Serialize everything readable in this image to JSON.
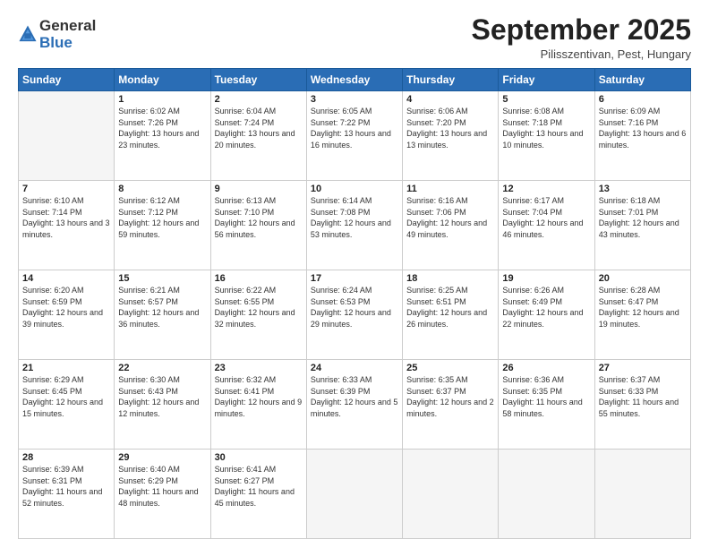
{
  "header": {
    "logo_general": "General",
    "logo_blue": "Blue",
    "month_title": "September 2025",
    "subtitle": "Pilisszentivan, Pest, Hungary"
  },
  "weekdays": [
    "Sunday",
    "Monday",
    "Tuesday",
    "Wednesday",
    "Thursday",
    "Friday",
    "Saturday"
  ],
  "weeks": [
    [
      {
        "day": "",
        "empty": true
      },
      {
        "day": "1",
        "sunrise": "6:02 AM",
        "sunset": "7:26 PM",
        "daylight": "13 hours and 23 minutes."
      },
      {
        "day": "2",
        "sunrise": "6:04 AM",
        "sunset": "7:24 PM",
        "daylight": "13 hours and 20 minutes."
      },
      {
        "day": "3",
        "sunrise": "6:05 AM",
        "sunset": "7:22 PM",
        "daylight": "13 hours and 16 minutes."
      },
      {
        "day": "4",
        "sunrise": "6:06 AM",
        "sunset": "7:20 PM",
        "daylight": "13 hours and 13 minutes."
      },
      {
        "day": "5",
        "sunrise": "6:08 AM",
        "sunset": "7:18 PM",
        "daylight": "13 hours and 10 minutes."
      },
      {
        "day": "6",
        "sunrise": "6:09 AM",
        "sunset": "7:16 PM",
        "daylight": "13 hours and 6 minutes."
      }
    ],
    [
      {
        "day": "7",
        "sunrise": "6:10 AM",
        "sunset": "7:14 PM",
        "daylight": "13 hours and 3 minutes."
      },
      {
        "day": "8",
        "sunrise": "6:12 AM",
        "sunset": "7:12 PM",
        "daylight": "12 hours and 59 minutes."
      },
      {
        "day": "9",
        "sunrise": "6:13 AM",
        "sunset": "7:10 PM",
        "daylight": "12 hours and 56 minutes."
      },
      {
        "day": "10",
        "sunrise": "6:14 AM",
        "sunset": "7:08 PM",
        "daylight": "12 hours and 53 minutes."
      },
      {
        "day": "11",
        "sunrise": "6:16 AM",
        "sunset": "7:06 PM",
        "daylight": "12 hours and 49 minutes."
      },
      {
        "day": "12",
        "sunrise": "6:17 AM",
        "sunset": "7:04 PM",
        "daylight": "12 hours and 46 minutes."
      },
      {
        "day": "13",
        "sunrise": "6:18 AM",
        "sunset": "7:01 PM",
        "daylight": "12 hours and 43 minutes."
      }
    ],
    [
      {
        "day": "14",
        "sunrise": "6:20 AM",
        "sunset": "6:59 PM",
        "daylight": "12 hours and 39 minutes."
      },
      {
        "day": "15",
        "sunrise": "6:21 AM",
        "sunset": "6:57 PM",
        "daylight": "12 hours and 36 minutes."
      },
      {
        "day": "16",
        "sunrise": "6:22 AM",
        "sunset": "6:55 PM",
        "daylight": "12 hours and 32 minutes."
      },
      {
        "day": "17",
        "sunrise": "6:24 AM",
        "sunset": "6:53 PM",
        "daylight": "12 hours and 29 minutes."
      },
      {
        "day": "18",
        "sunrise": "6:25 AM",
        "sunset": "6:51 PM",
        "daylight": "12 hours and 26 minutes."
      },
      {
        "day": "19",
        "sunrise": "6:26 AM",
        "sunset": "6:49 PM",
        "daylight": "12 hours and 22 minutes."
      },
      {
        "day": "20",
        "sunrise": "6:28 AM",
        "sunset": "6:47 PM",
        "daylight": "12 hours and 19 minutes."
      }
    ],
    [
      {
        "day": "21",
        "sunrise": "6:29 AM",
        "sunset": "6:45 PM",
        "daylight": "12 hours and 15 minutes."
      },
      {
        "day": "22",
        "sunrise": "6:30 AM",
        "sunset": "6:43 PM",
        "daylight": "12 hours and 12 minutes."
      },
      {
        "day": "23",
        "sunrise": "6:32 AM",
        "sunset": "6:41 PM",
        "daylight": "12 hours and 9 minutes."
      },
      {
        "day": "24",
        "sunrise": "6:33 AM",
        "sunset": "6:39 PM",
        "daylight": "12 hours and 5 minutes."
      },
      {
        "day": "25",
        "sunrise": "6:35 AM",
        "sunset": "6:37 PM",
        "daylight": "12 hours and 2 minutes."
      },
      {
        "day": "26",
        "sunrise": "6:36 AM",
        "sunset": "6:35 PM",
        "daylight": "11 hours and 58 minutes."
      },
      {
        "day": "27",
        "sunrise": "6:37 AM",
        "sunset": "6:33 PM",
        "daylight": "11 hours and 55 minutes."
      }
    ],
    [
      {
        "day": "28",
        "sunrise": "6:39 AM",
        "sunset": "6:31 PM",
        "daylight": "11 hours and 52 minutes."
      },
      {
        "day": "29",
        "sunrise": "6:40 AM",
        "sunset": "6:29 PM",
        "daylight": "11 hours and 48 minutes."
      },
      {
        "day": "30",
        "sunrise": "6:41 AM",
        "sunset": "6:27 PM",
        "daylight": "11 hours and 45 minutes."
      },
      {
        "day": "",
        "empty": true
      },
      {
        "day": "",
        "empty": true
      },
      {
        "day": "",
        "empty": true
      },
      {
        "day": "",
        "empty": true
      }
    ]
  ]
}
